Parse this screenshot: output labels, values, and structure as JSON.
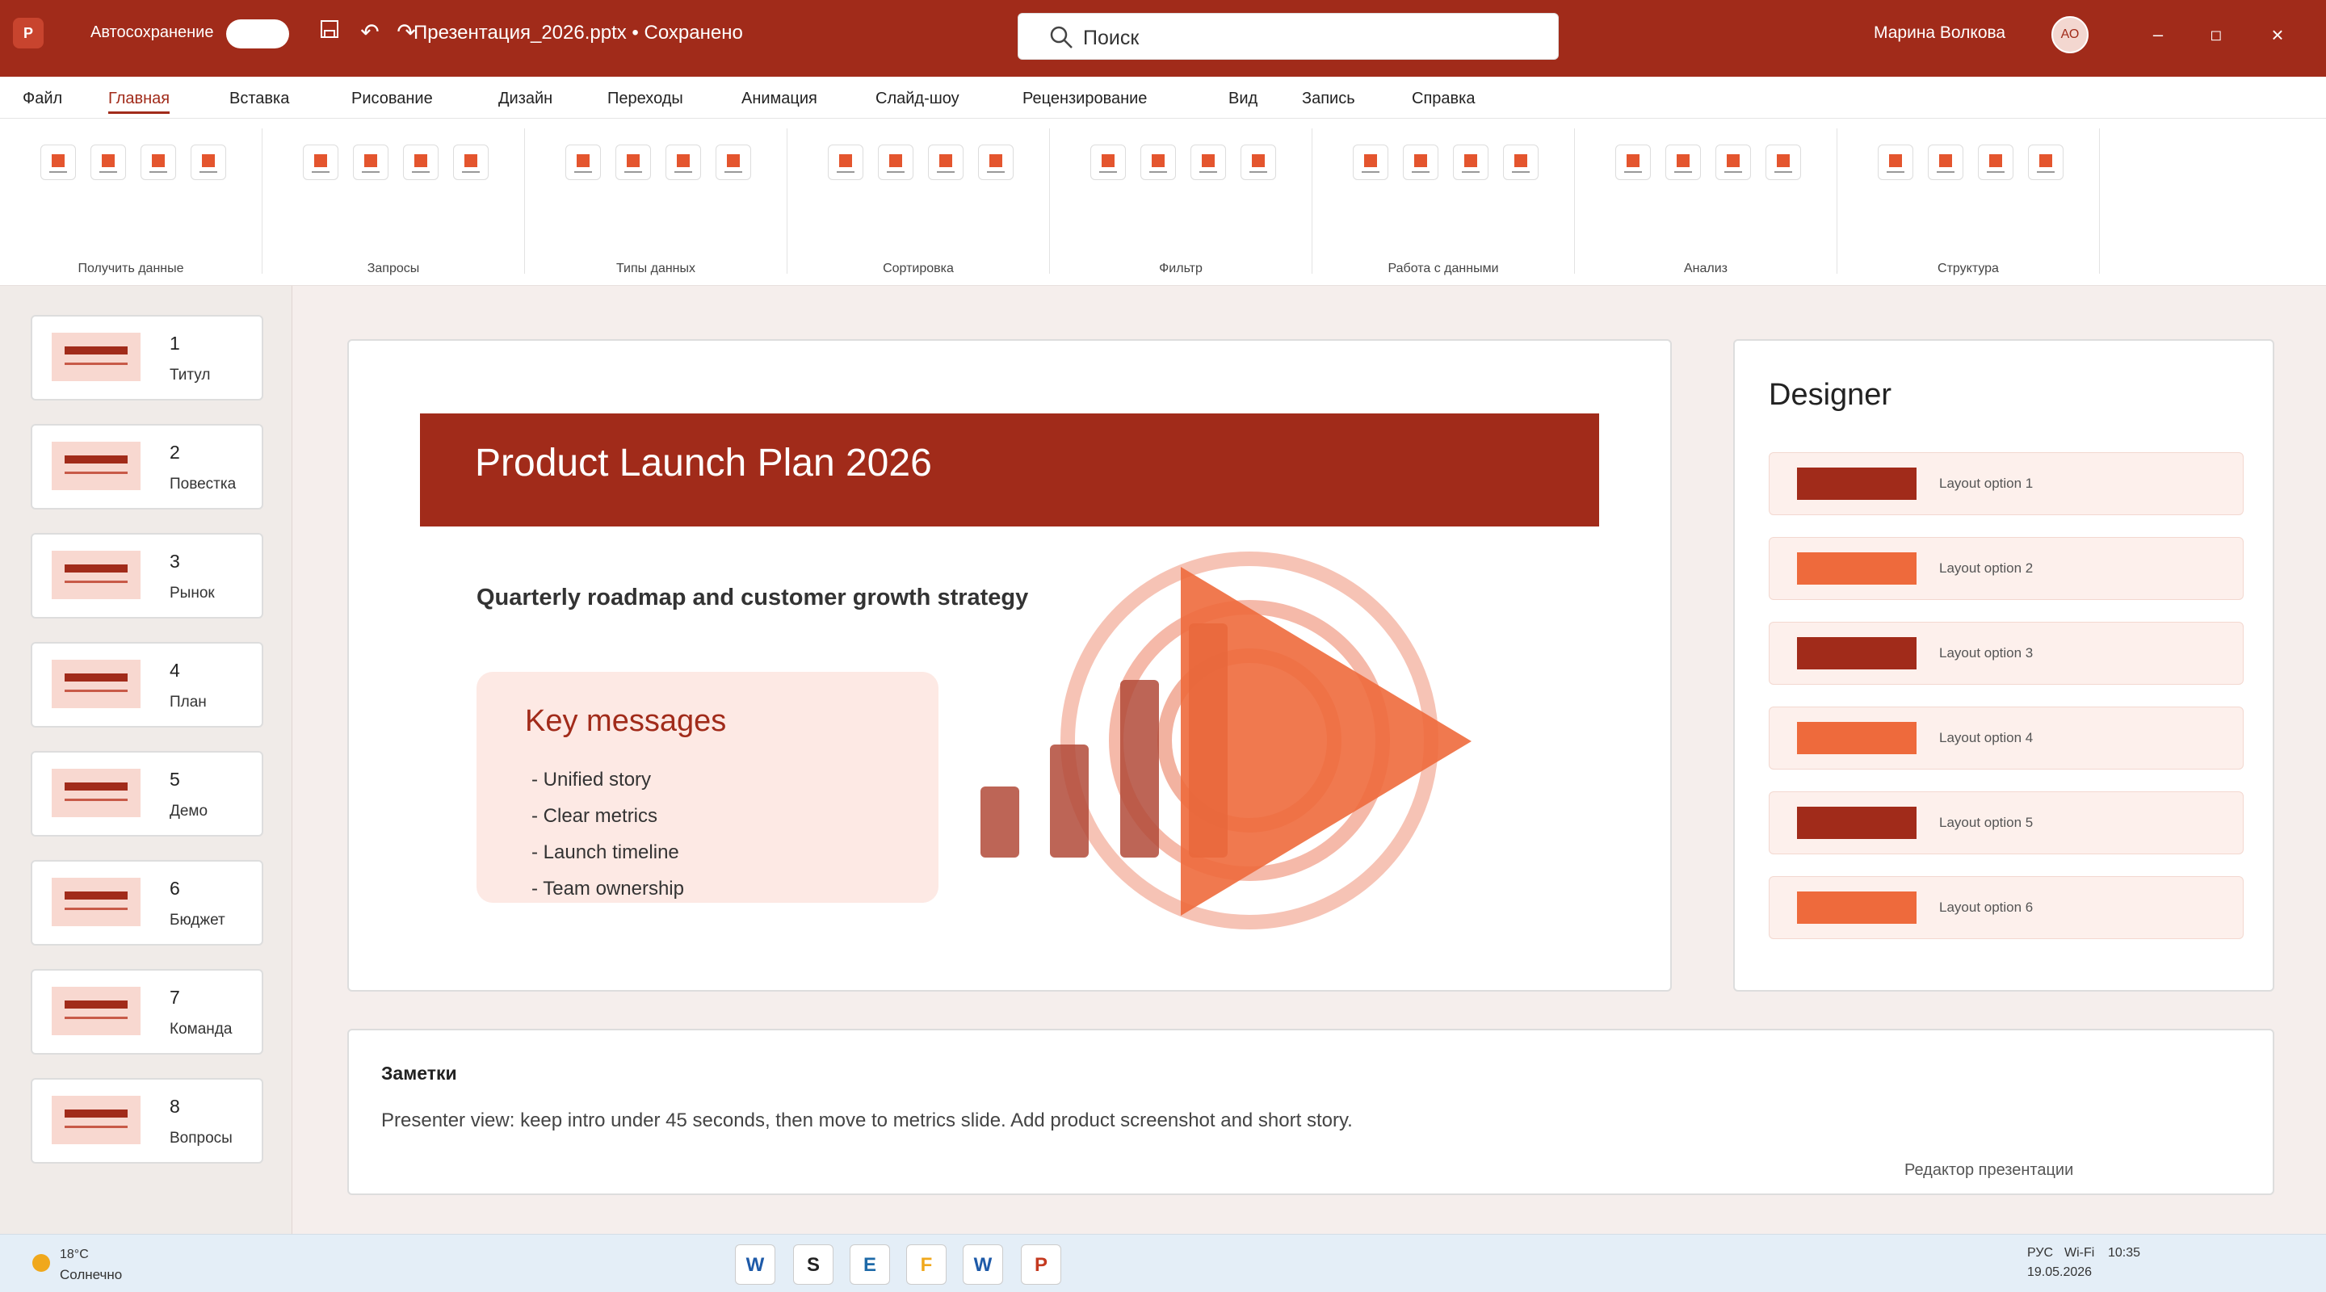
{
  "titlebar": {
    "app_letter": "P",
    "autosave_label": "Автосохранение",
    "document_title": "Презентация_2026.pptx • Сохранено",
    "search_placeholder": "Поиск",
    "user_name": "Марина Волкова",
    "user_initials": "АО",
    "minimize": "–",
    "maximize": "◻",
    "close": "×"
  },
  "ribbon": {
    "tabs": [
      "Файл",
      "Главная",
      "Вставка",
      "Рисование",
      "Дизайн",
      "Переходы",
      "Анимация",
      "Слайд-шоу",
      "Рецензирование",
      "Вид",
      "Запись",
      "Справка"
    ],
    "active_tab": "Главная",
    "groups": [
      "Получить данные",
      "Запросы",
      "Типы данных",
      "Сортировка",
      "Фильтр",
      "Работа с данными",
      "Анализ",
      "Структура"
    ]
  },
  "slides": [
    {
      "num": "1",
      "title": "Титул"
    },
    {
      "num": "2",
      "title": "Повестка"
    },
    {
      "num": "3",
      "title": "Рынок"
    },
    {
      "num": "4",
      "title": "План"
    },
    {
      "num": "5",
      "title": "Демо"
    },
    {
      "num": "6",
      "title": "Бюджет"
    },
    {
      "num": "7",
      "title": "Команда"
    },
    {
      "num": "8",
      "title": "Вопросы"
    }
  ],
  "slide": {
    "title": "Product Launch Plan 2026",
    "subtitle": "Quarterly roadmap and customer growth strategy",
    "key_title": "Key messages",
    "key_items": [
      "- Unified story",
      "- Clear metrics",
      "- Launch timeline",
      "- Team ownership"
    ]
  },
  "designer": {
    "title": "Designer",
    "options": [
      {
        "label": "Layout option 1",
        "color": "#a12b1a"
      },
      {
        "label": "Layout option 2",
        "color": "#ee6a3c"
      },
      {
        "label": "Layout option 3",
        "color": "#a12b1a"
      },
      {
        "label": "Layout option 4",
        "color": "#ee6a3c"
      },
      {
        "label": "Layout option 5",
        "color": "#a12b1a"
      },
      {
        "label": "Layout option 6",
        "color": "#ee6a3c"
      }
    ]
  },
  "notes": {
    "title": "Заметки",
    "text": "Presenter view: keep intro under 45 seconds, then move to metrics slide. Add product screenshot and short story.",
    "editor_label": "Редактор презентации"
  },
  "taskbar": {
    "weather_temp": "18°C",
    "weather_desc": "Солнечно",
    "apps": [
      {
        "letter": "W",
        "color": "#1e5aa8"
      },
      {
        "letter": "S",
        "color": "#222222"
      },
      {
        "letter": "E",
        "color": "#1e6aa8"
      },
      {
        "letter": "F",
        "color": "#f0a81c"
      },
      {
        "letter": "W",
        "color": "#1e5aa8"
      },
      {
        "letter": "P",
        "color": "#c43a20"
      }
    ],
    "lang": "РУС",
    "wifi": "Wi-Fi",
    "time": "10:35",
    "date": "19.05.2026"
  },
  "colors": {
    "brand": "#a12b1a",
    "accent": "#ee6a3c"
  }
}
